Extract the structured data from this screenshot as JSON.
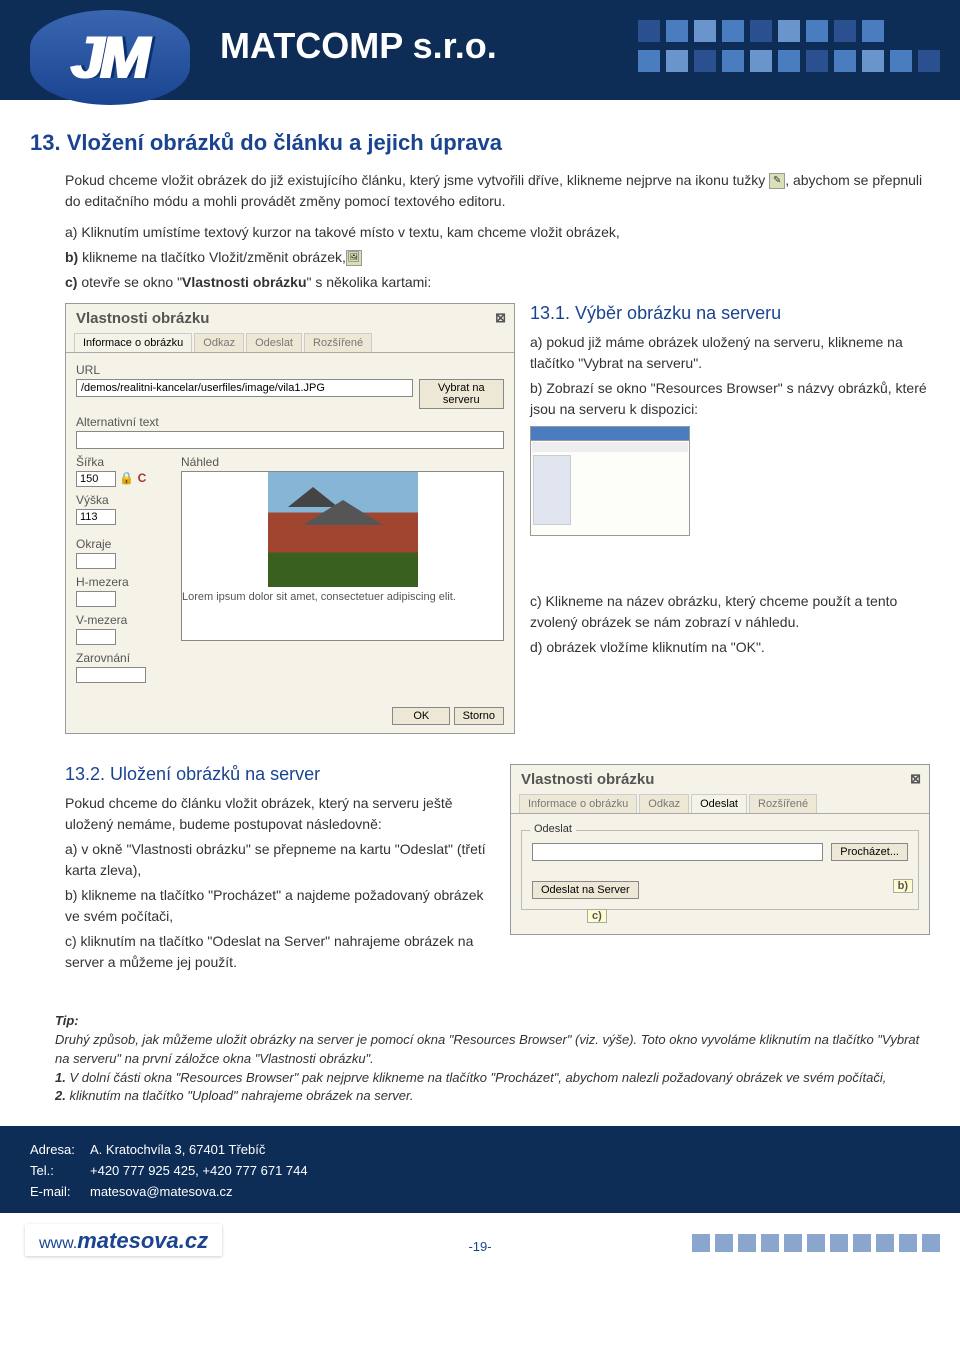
{
  "brand": "MATCOMP s.r.o.",
  "logo": "JM",
  "h1": "13. Vložení obrázků do článku a jejich úprava",
  "intro": "Pokud chceme vložit obrázek do již existujícího článku, který jsme vytvořili dříve, klikneme nejprve na ikonu tužky , abychom se přepnuli do editačního módu a mohli provádět změny pomocí textového editoru.",
  "intro_a": "a) Kliknutím umístíme textový kurzor na takové místo v textu, kam chceme vložit obrázek,",
  "intro_b": "b) klikneme na tlačítko Vložit/změnit obrázek,",
  "intro_c": "c) otevře se okno \"Vlastnosti obrázku\" s několika kartami:",
  "dlg1": {
    "title": "Vlastnosti obrázku",
    "tabs": [
      "Informace o obrázku",
      "Odkaz",
      "Odeslat",
      "Rozšířené"
    ],
    "url_label": "URL",
    "url_value": "/demos/realitni-kancelar/userfiles/image/vila1.JPG",
    "browse_btn": "Vybrat na serveru",
    "alt_label": "Alternativní text",
    "preview_label": "Náhled",
    "width_label": "Šířka",
    "width_value": "150",
    "height_label": "Výška",
    "height_value": "113",
    "okraje": "Okraje",
    "hmezera": "H-mezera",
    "vmezera": "V-mezera",
    "zarovnani": "Zarovnání",
    "lorem": "Lorem ipsum dolor sit amet, consectetuer adipiscing elit.",
    "ok": "OK",
    "storno": "Storno"
  },
  "sec131": {
    "title": "13.1. Výběr obrázku na serveru",
    "a": "a) pokud již máme obrázek uložený na serveru, klikneme na tlačítko \"Vybrat na serveru\".",
    "b": "b) Zobrazí se okno \"Resources Browser\" s názvy obrázků, které jsou na serveru k dispozici:",
    "c": "c) Klikneme na název obrázku, který chceme použít a tento zvolený obrázek se nám zobrazí v náhledu.",
    "d": "d) obrázek vložíme kliknutím na \"OK\"."
  },
  "sec132": {
    "title": "13.2. Uložení obrázků na server",
    "intro": "Pokud chceme do článku vložit obrázek, který na serveru ještě uložený nemáme, budeme postupovat následovně:",
    "a": "a) v okně \"Vlastnosti obrázku\" se přepneme na kartu \"Odeslat\" (třetí karta zleva),",
    "b": "b) klikneme na tlačítko \"Procházet\" a najdeme požadovaný obrázek ve svém počítači,",
    "c": "c) kliknutím na tlačítko \"Odeslat na Server\" nahrajeme obrázek na server a můžeme jej použít."
  },
  "dlg2": {
    "title": "Vlastnosti obrázku",
    "tabs": [
      "Informace o obrázku",
      "Odkaz",
      "Odeslat",
      "Rozšířené"
    ],
    "legend": "Odeslat",
    "browse": "Procházet...",
    "send": "Odeslat na Server",
    "call_b": "b)",
    "call_c": "c)"
  },
  "tip": {
    "title": "Tip:",
    "l1": "Druhý způsob, jak můžeme uložit obrázky na server je pomocí okna \"Resources Browser\" (viz. výše). Toto okno vyvoláme kliknutím na tlačítko \"Vybrat na serveru\" na první záložce okna \"Vlastnosti obrázku\".",
    "l2": "1. V dolní části okna \"Resources Browser\" pak nejprve klikneme na tlačítko \"Procházet\", abychom nalezli požadovaný obrázek ve svém počítači,",
    "l3": "2. kliknutím na tlačítko \"Upload\" nahrajeme obrázek na server."
  },
  "footer": {
    "address_label": "Adresa:",
    "address": "A. Kratochvíla 3, 67401 Třebíč",
    "tel_label": "Tel.:",
    "tel": "+420 777 925 425, +420 777 671 744",
    "email_label": "E-mail:",
    "email": "matesova@matesova.cz",
    "site_www": "www.",
    "site_name": "matesova",
    "site_tld": ".cz",
    "page": "-19-"
  }
}
